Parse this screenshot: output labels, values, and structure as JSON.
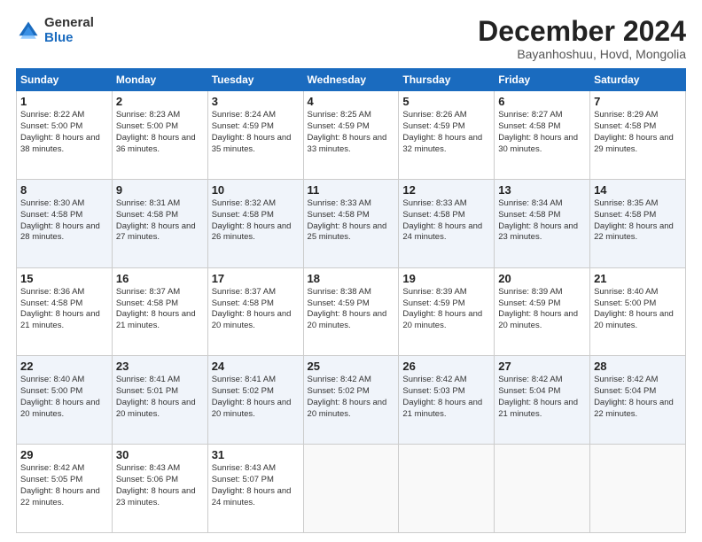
{
  "logo": {
    "general": "General",
    "blue": "Blue"
  },
  "title": "December 2024",
  "location": "Bayanhoshuu, Hovd, Mongolia",
  "headers": [
    "Sunday",
    "Monday",
    "Tuesday",
    "Wednesday",
    "Thursday",
    "Friday",
    "Saturday"
  ],
  "weeks": [
    [
      {
        "day": "1",
        "text": "Sunrise: 8:22 AM\nSunset: 5:00 PM\nDaylight: 8 hours and 38 minutes."
      },
      {
        "day": "2",
        "text": "Sunrise: 8:23 AM\nSunset: 5:00 PM\nDaylight: 8 hours and 36 minutes."
      },
      {
        "day": "3",
        "text": "Sunrise: 8:24 AM\nSunset: 4:59 PM\nDaylight: 8 hours and 35 minutes."
      },
      {
        "day": "4",
        "text": "Sunrise: 8:25 AM\nSunset: 4:59 PM\nDaylight: 8 hours and 33 minutes."
      },
      {
        "day": "5",
        "text": "Sunrise: 8:26 AM\nSunset: 4:59 PM\nDaylight: 8 hours and 32 minutes."
      },
      {
        "day": "6",
        "text": "Sunrise: 8:27 AM\nSunset: 4:58 PM\nDaylight: 8 hours and 30 minutes."
      },
      {
        "day": "7",
        "text": "Sunrise: 8:29 AM\nSunset: 4:58 PM\nDaylight: 8 hours and 29 minutes."
      }
    ],
    [
      {
        "day": "8",
        "text": "Sunrise: 8:30 AM\nSunset: 4:58 PM\nDaylight: 8 hours and 28 minutes."
      },
      {
        "day": "9",
        "text": "Sunrise: 8:31 AM\nSunset: 4:58 PM\nDaylight: 8 hours and 27 minutes."
      },
      {
        "day": "10",
        "text": "Sunrise: 8:32 AM\nSunset: 4:58 PM\nDaylight: 8 hours and 26 minutes."
      },
      {
        "day": "11",
        "text": "Sunrise: 8:33 AM\nSunset: 4:58 PM\nDaylight: 8 hours and 25 minutes."
      },
      {
        "day": "12",
        "text": "Sunrise: 8:33 AM\nSunset: 4:58 PM\nDaylight: 8 hours and 24 minutes."
      },
      {
        "day": "13",
        "text": "Sunrise: 8:34 AM\nSunset: 4:58 PM\nDaylight: 8 hours and 23 minutes."
      },
      {
        "day": "14",
        "text": "Sunrise: 8:35 AM\nSunset: 4:58 PM\nDaylight: 8 hours and 22 minutes."
      }
    ],
    [
      {
        "day": "15",
        "text": "Sunrise: 8:36 AM\nSunset: 4:58 PM\nDaylight: 8 hours and 21 minutes."
      },
      {
        "day": "16",
        "text": "Sunrise: 8:37 AM\nSunset: 4:58 PM\nDaylight: 8 hours and 21 minutes."
      },
      {
        "day": "17",
        "text": "Sunrise: 8:37 AM\nSunset: 4:58 PM\nDaylight: 8 hours and 20 minutes."
      },
      {
        "day": "18",
        "text": "Sunrise: 8:38 AM\nSunset: 4:59 PM\nDaylight: 8 hours and 20 minutes."
      },
      {
        "day": "19",
        "text": "Sunrise: 8:39 AM\nSunset: 4:59 PM\nDaylight: 8 hours and 20 minutes."
      },
      {
        "day": "20",
        "text": "Sunrise: 8:39 AM\nSunset: 4:59 PM\nDaylight: 8 hours and 20 minutes."
      },
      {
        "day": "21",
        "text": "Sunrise: 8:40 AM\nSunset: 5:00 PM\nDaylight: 8 hours and 20 minutes."
      }
    ],
    [
      {
        "day": "22",
        "text": "Sunrise: 8:40 AM\nSunset: 5:00 PM\nDaylight: 8 hours and 20 minutes."
      },
      {
        "day": "23",
        "text": "Sunrise: 8:41 AM\nSunset: 5:01 PM\nDaylight: 8 hours and 20 minutes."
      },
      {
        "day": "24",
        "text": "Sunrise: 8:41 AM\nSunset: 5:02 PM\nDaylight: 8 hours and 20 minutes."
      },
      {
        "day": "25",
        "text": "Sunrise: 8:42 AM\nSunset: 5:02 PM\nDaylight: 8 hours and 20 minutes."
      },
      {
        "day": "26",
        "text": "Sunrise: 8:42 AM\nSunset: 5:03 PM\nDaylight: 8 hours and 21 minutes."
      },
      {
        "day": "27",
        "text": "Sunrise: 8:42 AM\nSunset: 5:04 PM\nDaylight: 8 hours and 21 minutes."
      },
      {
        "day": "28",
        "text": "Sunrise: 8:42 AM\nSunset: 5:04 PM\nDaylight: 8 hours and 22 minutes."
      }
    ],
    [
      {
        "day": "29",
        "text": "Sunrise: 8:42 AM\nSunset: 5:05 PM\nDaylight: 8 hours and 22 minutes."
      },
      {
        "day": "30",
        "text": "Sunrise: 8:43 AM\nSunset: 5:06 PM\nDaylight: 8 hours and 23 minutes."
      },
      {
        "day": "31",
        "text": "Sunrise: 8:43 AM\nSunset: 5:07 PM\nDaylight: 8 hours and 24 minutes."
      },
      null,
      null,
      null,
      null
    ]
  ]
}
